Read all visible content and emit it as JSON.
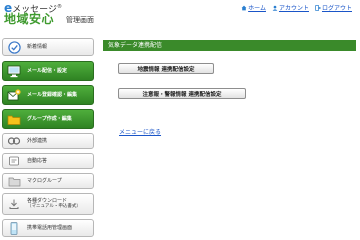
{
  "header": {
    "brand_top": "メッセージ",
    "brand_e": "e",
    "brand_reg": "®",
    "brand_main": "地域安心",
    "brand_sub": "管理画面",
    "links": [
      {
        "label": "ホーム",
        "icon": "home-icon"
      },
      {
        "label": "アカウント",
        "icon": "account-icon"
      },
      {
        "label": "ログアウト",
        "icon": "logout-icon"
      }
    ]
  },
  "sidebar": {
    "items": [
      {
        "label": "新着情報",
        "icon": "check-circle-icon",
        "active": false
      },
      {
        "label": "メール配信・設定",
        "icon": "monitor-icon",
        "active": true
      },
      {
        "label": "メール登録確認・編集",
        "icon": "mail-add-icon",
        "active": true
      },
      {
        "label": "グループ作成・編集",
        "icon": "folder-icon",
        "active": true
      },
      {
        "label": "外部連携",
        "icon": "link-icon",
        "active": false
      },
      {
        "label": "自動応答",
        "icon": "auto-reply-icon",
        "active": false
      },
      {
        "label": "マクログループ",
        "icon": "macro-group-icon",
        "active": false
      },
      {
        "label": "各種ダウンロード",
        "label2": "（マニュアル・申込書式）",
        "icon": "download-icon",
        "active": false
      },
      {
        "label": "携帯電話用管理画面",
        "icon": "mobile-icon",
        "active": false
      }
    ]
  },
  "main": {
    "section_title": "気象データ連携配信",
    "buttons": [
      {
        "label": "地震情報 連携配信設定"
      },
      {
        "label": "注意報・警報情報 連携配信設定"
      }
    ],
    "back_link": "メニューに戻る"
  },
  "colors": {
    "accent_green": "#3a8a2a",
    "brand_green": "#3f9a2f",
    "link_blue": "#1a55c8"
  }
}
